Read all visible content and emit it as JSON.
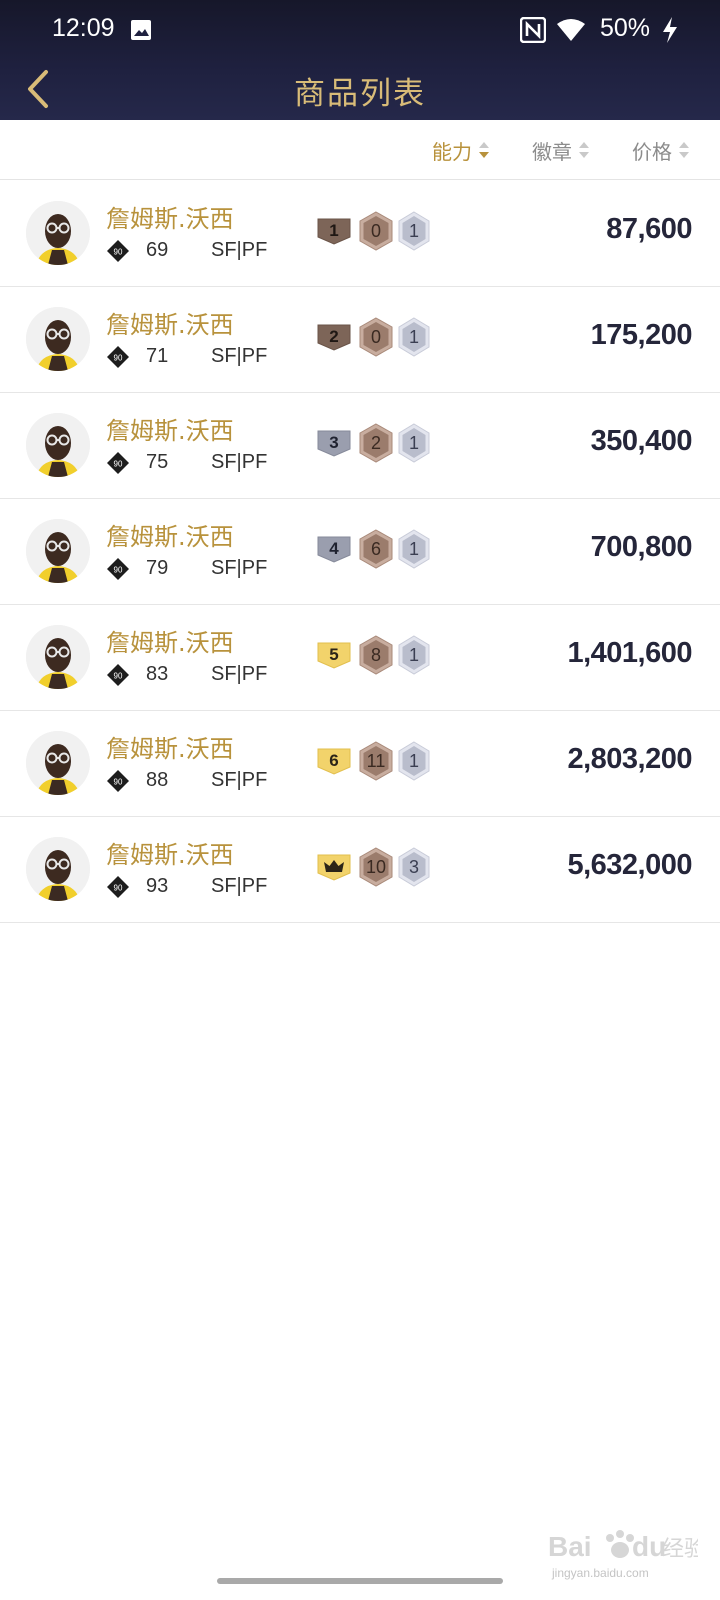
{
  "status_bar": {
    "time": "12:09",
    "battery": "50%",
    "icons": [
      "image-icon",
      "nfc-icon",
      "wifi-icon",
      "charging-icon"
    ]
  },
  "app_bar": {
    "title": "商品列表",
    "back_icon": "chevron-left-icon"
  },
  "sort_bar": {
    "ability_label": "能力",
    "badge_label": "徽章",
    "price_label": "价格",
    "active": "ability"
  },
  "colors": {
    "accent_gold": "#b8923c",
    "title_gold": "#d9bc78",
    "header_dark": "#1f2140",
    "price_text": "#25263a"
  },
  "items": [
    {
      "name": "詹姆斯.沃西",
      "ovr_icon_text": "90",
      "rating": "69",
      "position": "SF|PF",
      "level": "1",
      "level_tier": "bronze",
      "copper_badges": "0",
      "silver_badges": "1",
      "price": "87,600"
    },
    {
      "name": "詹姆斯.沃西",
      "ovr_icon_text": "90",
      "rating": "71",
      "position": "SF|PF",
      "level": "2",
      "level_tier": "bronze",
      "copper_badges": "0",
      "silver_badges": "1",
      "price": "175,200"
    },
    {
      "name": "詹姆斯.沃西",
      "ovr_icon_text": "90",
      "rating": "75",
      "position": "SF|PF",
      "level": "3",
      "level_tier": "silver",
      "copper_badges": "2",
      "silver_badges": "1",
      "price": "350,400"
    },
    {
      "name": "詹姆斯.沃西",
      "ovr_icon_text": "90",
      "rating": "79",
      "position": "SF|PF",
      "level": "4",
      "level_tier": "silver",
      "copper_badges": "6",
      "silver_badges": "1",
      "price": "700,800"
    },
    {
      "name": "詹姆斯.沃西",
      "ovr_icon_text": "90",
      "rating": "83",
      "position": "SF|PF",
      "level": "5",
      "level_tier": "gold",
      "copper_badges": "8",
      "silver_badges": "1",
      "price": "1,401,600"
    },
    {
      "name": "詹姆斯.沃西",
      "ovr_icon_text": "90",
      "rating": "88",
      "position": "SF|PF",
      "level": "6",
      "level_tier": "gold",
      "copper_badges": "11",
      "silver_badges": "1",
      "price": "2,803,200"
    },
    {
      "name": "詹姆斯.沃西",
      "ovr_icon_text": "90",
      "rating": "93",
      "position": "SF|PF",
      "level": "",
      "level_tier": "crown",
      "copper_badges": "10",
      "silver_badges": "3",
      "price": "5,632,000"
    }
  ],
  "watermark": {
    "text": "jingyan.baidu.com"
  }
}
